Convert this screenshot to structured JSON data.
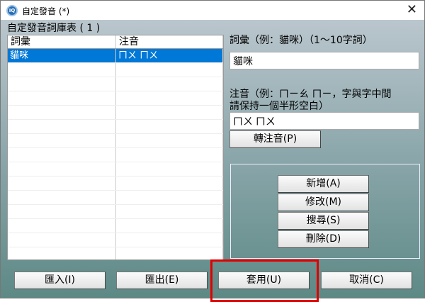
{
  "window": {
    "title": "自定發音 (*)",
    "icon": "app-iq-icon",
    "close": "✕"
  },
  "list": {
    "label": "自定發音詞庫表 ( 1 )",
    "columns": [
      "詞彙",
      "注音"
    ],
    "rows": [
      {
        "word": "貓咪",
        "zhuyin": "ㄇㄨ ㄇㄨ",
        "selected": true
      }
    ]
  },
  "form": {
    "word_label": "詞彙（例：貓咪）（1～10字詞）",
    "word_value": "貓咪",
    "zhuyin_label_1": "注音（例：ㄇㄧㄠ ㄇㄧ，字與字中間",
    "zhuyin_label_2": "請保持一個半形空白）",
    "zhuyin_value": "ㄇㄨ ㄇㄨ",
    "convert_button": "轉注音(P)"
  },
  "actions": {
    "add": "新增(A)",
    "modify": "修改(M)",
    "search": "搜尋(S)",
    "delete": "刪除(D)"
  },
  "bottom": {
    "import": "匯入(I)",
    "export": "匯出(E)",
    "apply": "套用(U)",
    "cancel": "取消(C)"
  },
  "colors": {
    "selection": "#0078d7",
    "highlight": "#e00000"
  }
}
